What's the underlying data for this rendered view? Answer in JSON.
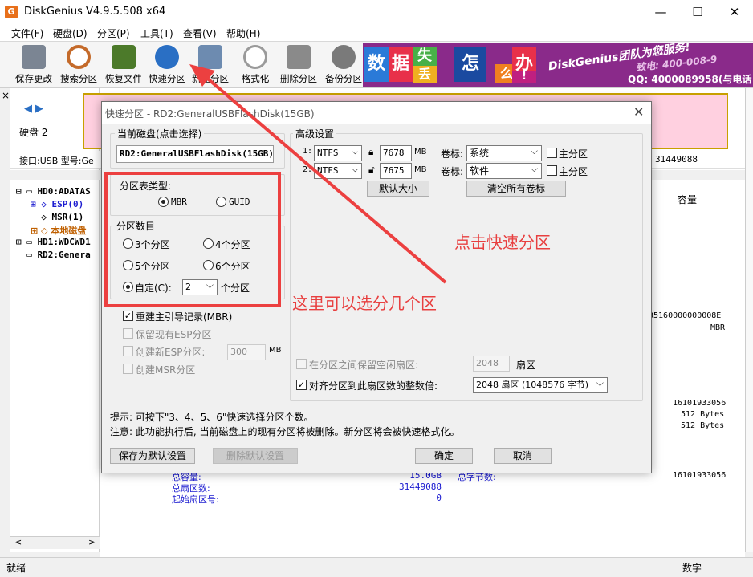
{
  "window": {
    "title": "DiskGenius V4.9.5.508 x64",
    "icon": "diskgenius-logo-icon",
    "icon_glyph": "G",
    "controls": [
      "—",
      "☐",
      "✕"
    ]
  },
  "menu": [
    "文件(F)",
    "硬盘(D)",
    "分区(P)",
    "工具(T)",
    "查看(V)",
    "帮助(H)"
  ],
  "toolbar": [
    {
      "label": "保存更改",
      "icon": "save-disk-icon",
      "color": "#7b8593"
    },
    {
      "label": "搜索分区",
      "icon": "magnifier-icon",
      "color": "#c46a2a"
    },
    {
      "label": "恢复文件",
      "icon": "recover-box-icon",
      "color": "#4c7a2a"
    },
    {
      "label": "快速分区",
      "icon": "quick-partition-icon",
      "color": "#2a6fc4"
    },
    {
      "label": "新建分区",
      "icon": "new-partition-icon",
      "color": "#6d8bb0"
    },
    {
      "label": "格式化",
      "icon": "format-icon",
      "color": "#9a9a9a"
    },
    {
      "label": "删除分区",
      "icon": "trash-icon",
      "color": "#8a8a8a"
    },
    {
      "label": "备份分区",
      "icon": "backup-disc-icon",
      "color": "#7a7a7a"
    }
  ],
  "banner": {
    "tiles": [
      {
        "char": "数",
        "bg": "#2a7ad8"
      },
      {
        "char": "据",
        "bg": "#e8304a"
      },
      {
        "char": "失",
        "bg": "#48b048"
      },
      {
        "char": "丢",
        "bg": "#f0b020"
      },
      {
        "char": "怎",
        "bg": "#1a4aa0"
      },
      {
        "char": "么",
        "bg": "#f08020"
      },
      {
        "char": "办",
        "bg": "#e8304a"
      },
      {
        "char": "!",
        "bg": "#c02080"
      }
    ],
    "slogan": "DiskGenius团队为您服务!",
    "phone": "致电: 400-008-9",
    "qq": "QQ: 4000089958(与电话"
  },
  "background": {
    "disk_label": "硬盘 2",
    "interface": "接口:USB  型号:Ge",
    "sectors_right": "31449088",
    "col_capacity": "容量",
    "tree": [
      {
        "label": "HD0:ADATAS",
        "color": "#000"
      },
      {
        "label": "ESP(0)",
        "color": "#1a1ad0"
      },
      {
        "label": "MSR(1)",
        "color": "#000"
      },
      {
        "label": "本地磁盘",
        "color": "#c06000"
      },
      {
        "label": "HD1:WDCWD1",
        "color": "#000"
      },
      {
        "label": "RD2:Genera",
        "color": "#000"
      }
    ],
    "right_values": [
      "35160000000008E",
      "MBR",
      "16101933056",
      "512 Bytes",
      "512 Bytes",
      "16101933056"
    ],
    "bottom_rows": [
      {
        "label": "总容量:",
        "value": "15.0GB"
      },
      {
        "label": "总扇区数:",
        "value": "31449088"
      },
      {
        "label": "起始扇区号:",
        "value": "0"
      }
    ],
    "sector_bytes_label": "总字节数:",
    "status_left": "就绪",
    "status_right": "数字"
  },
  "dialog": {
    "title": "快速分区 - RD2:GeneralUSBFlashDisk(15GB)",
    "current_disk_label": "当前磁盘(点击选择)",
    "current_disk_value": "RD2:GeneralUSBFlashDisk(15GB)",
    "partition_table_label": "分区表类型:",
    "mbr": "MBR",
    "guid": "GUID",
    "count_label": "分区数目",
    "opt3": "3个分区",
    "opt4": "4个分区",
    "opt5": "5个分区",
    "opt6": "6个分区",
    "custom": "自定(C):",
    "custom_value": "2",
    "custom_suffix": "个分区",
    "rebuild_mbr": "重建主引导记录(MBR)",
    "keep_esp": "保留现有ESP分区",
    "create_esp": "创建新ESP分区:",
    "esp_size": "300",
    "esp_unit": "MB",
    "create_msr": "创建MSR分区",
    "advanced_label": "高级设置",
    "partitions": [
      {
        "idx": "1:",
        "fs": "NTFS",
        "size": "7678",
        "unit": "MB",
        "label_caption": "卷标:",
        "label": "系统",
        "primary": "主分区"
      },
      {
        "idx": "2:",
        "fs": "NTFS",
        "size": "7675",
        "unit": "MB",
        "label_caption": "卷标:",
        "label": "软件",
        "primary": "主分区"
      }
    ],
    "default_size_btn": "默认大小",
    "clear_labels_btn": "清空所有卷标",
    "keep_free": "在分区之间保留空闲扇区:",
    "keep_free_value": "2048",
    "keep_free_unit": "扇区",
    "align": "对齐分区到此扇区数的整数倍:",
    "align_value": "2048 扇区 (1048576 字节)",
    "hint1": "提示: 可按下\"3、4、5、6\"快速选择分区个数。",
    "hint2": "注意: 此功能执行后, 当前磁盘上的现有分区将被删除。新分区将会被快速格式化。",
    "save_default_btn": "保存为默认设置",
    "delete_default_btn": "删除默认设置",
    "ok_btn": "确定",
    "cancel_btn": "取消",
    "close": "✕"
  },
  "annotations": {
    "click_quick": "点击快速分区",
    "choose_count": "这里可以选分几个区",
    "color": "#ec4040"
  }
}
